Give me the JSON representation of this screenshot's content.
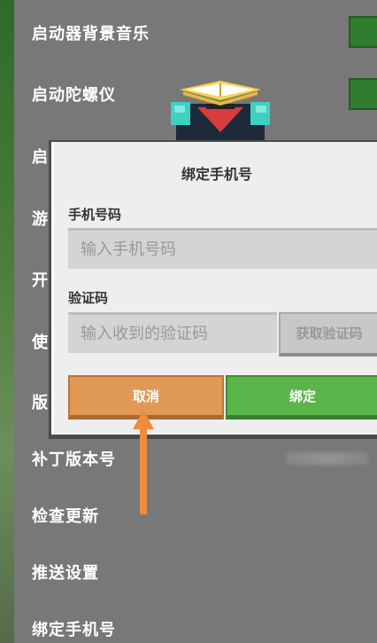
{
  "settings": {
    "rows": [
      {
        "label": "启动器背景音乐"
      },
      {
        "label": "启动陀螺仪"
      },
      {
        "label": "启"
      },
      {
        "label": "游"
      },
      {
        "label": "开"
      },
      {
        "label": "使"
      },
      {
        "label": "版"
      },
      {
        "label": "补丁版本号"
      },
      {
        "label": "检查更新"
      },
      {
        "label": "推送设置"
      },
      {
        "label": "绑定手机号"
      }
    ]
  },
  "dialog": {
    "title": "绑定手机号",
    "phone_label": "手机号码",
    "phone_placeholder": "输入手机号码",
    "code_label": "验证码",
    "code_placeholder": "输入收到的验证码",
    "get_code_label": "获取验证码",
    "cancel_label": "取消",
    "bind_label": "绑定"
  },
  "colors": {
    "accent_green": "#5ab54a",
    "accent_orange": "#e09a55",
    "arrow": "#f08b3c"
  },
  "icons": [
    "mascot-icon",
    "arrow-icon"
  ]
}
